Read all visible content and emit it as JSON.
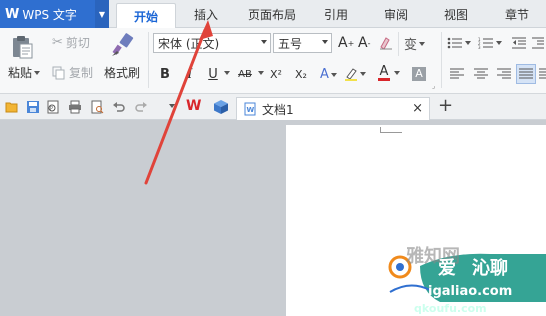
{
  "app": {
    "name": "WPS 文字"
  },
  "tabs": [
    {
      "label": "开始",
      "active": true
    },
    {
      "label": "插入"
    },
    {
      "label": "页面布局"
    },
    {
      "label": "引用"
    },
    {
      "label": "审阅"
    },
    {
      "label": "视图"
    },
    {
      "label": "章节"
    }
  ],
  "ribbon": {
    "paste_label": "粘贴",
    "cut_label": "剪切",
    "copy_label": "复制",
    "format_painter_label": "格式刷",
    "font_name": "宋体 (正文)",
    "font_size": "五号",
    "style_buttons": [
      "B",
      "I",
      "U",
      "AB",
      "X²",
      "X₂"
    ]
  },
  "document": {
    "tab_title": "文档1",
    "close_symbol": "×",
    "new_tab_symbol": "+"
  },
  "watermark": {
    "line1": "爱",
    "line2": "沁聊",
    "domain": "igaliao.com",
    "sub": "qkoufu.com"
  },
  "colors": {
    "accent": "#2f6fd0",
    "active_tab_text": "#1b66d6",
    "arrow": "#e0433a",
    "font_color_bar": "#d8262b"
  }
}
